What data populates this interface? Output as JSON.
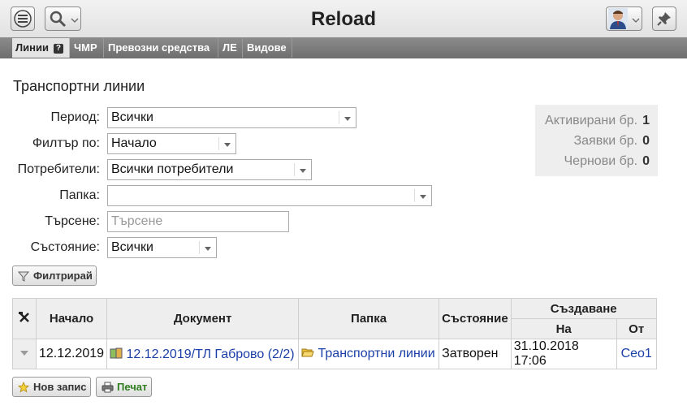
{
  "header": {
    "title": "Reload"
  },
  "tabs": [
    {
      "label": "Линии",
      "active": true,
      "help": "?"
    },
    {
      "label": "ЧМР"
    },
    {
      "label": "Превозни средства"
    },
    {
      "label": "ЛЕ"
    },
    {
      "label": "Видове"
    }
  ],
  "page": {
    "title": "Транспортни линии"
  },
  "filters": {
    "period": {
      "label": "Период:",
      "value": "Всички"
    },
    "filter_by": {
      "label": "Филтър по:",
      "value": "Начало"
    },
    "users": {
      "label": "Потребители:",
      "value": "Всички потребители"
    },
    "folder": {
      "label": "Папка:",
      "value": ""
    },
    "search": {
      "label": "Търсене:",
      "placeholder": "Търсене"
    },
    "state": {
      "label": "Състояние:",
      "value": "Всички"
    }
  },
  "stats": [
    {
      "label": "Активирани бр.",
      "value": "1"
    },
    {
      "label": "Заявки бр.",
      "value": "0"
    },
    {
      "label": "Чернови бр.",
      "value": "0"
    }
  ],
  "buttons": {
    "filter": "Филтрирай",
    "new": "Нов запис",
    "print": "Печат"
  },
  "table": {
    "headers": {
      "start": "Начало",
      "document": "Документ",
      "folder": "Папка",
      "state": "Състояние",
      "created": "Създаване",
      "on": "На",
      "by": "От"
    },
    "rows": [
      {
        "start": "12.12.2019",
        "document": "12.12.2019/ТЛ Габрово (2/2)",
        "folder": "Транспортни линии",
        "state": "Затворен",
        "created_on": "31.10.2018 17:06",
        "created_by": "Ceo1"
      }
    ]
  },
  "colors": {
    "link": "#1a3fa8",
    "tabbar": "#7a7a7a"
  }
}
